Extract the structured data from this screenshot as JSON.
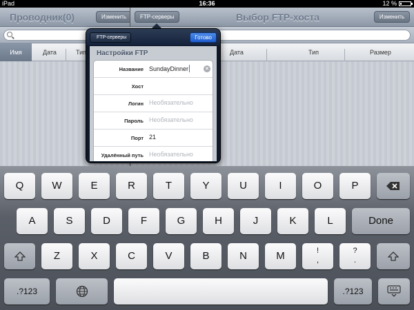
{
  "status": {
    "device": "iPad",
    "time": "16:36",
    "battery": "12 %"
  },
  "left_panel": {
    "title": "Проводник(0)",
    "edit_button": "Изменить"
  },
  "right_panel": {
    "back_button": "FTP-серверы",
    "title": "Выбор FTP-хоста",
    "edit_button": "Изменить"
  },
  "columns": {
    "name": "Имя",
    "date_left": "Дата",
    "type_left": "Тип",
    "date_right": "Дата",
    "type_right": "Тип",
    "size": "Размер"
  },
  "popover": {
    "back_button": "FTP-серверы",
    "done_button": "Готово",
    "section_title": "Настройки FTP",
    "rows": [
      {
        "label": "Название",
        "value": "SundayDinner",
        "placeholder": ""
      },
      {
        "label": "Хост",
        "value": "",
        "placeholder": ""
      },
      {
        "label": "Логин",
        "value": "",
        "placeholder": "Необязательно"
      },
      {
        "label": "Пароль",
        "value": "",
        "placeholder": "Необязательно"
      },
      {
        "label": "Порт",
        "value": "21",
        "placeholder": ""
      },
      {
        "label": "Удалённый путь",
        "value": "",
        "placeholder": "Необязательно"
      }
    ]
  },
  "keyboard": {
    "row1": [
      "Q",
      "W",
      "E",
      "R",
      "T",
      "Y",
      "U",
      "I",
      "O",
      "P"
    ],
    "row2": [
      "A",
      "S",
      "D",
      "F",
      "G",
      "H",
      "J",
      "K",
      "L"
    ],
    "row3": [
      "Z",
      "X",
      "C",
      "V",
      "B",
      "N",
      "M"
    ],
    "punct1": [
      "!",
      ","
    ],
    "punct2": [
      "?",
      "."
    ],
    "done": "Done",
    "numbers": ".?123",
    "numbers_right": ".?123"
  }
}
